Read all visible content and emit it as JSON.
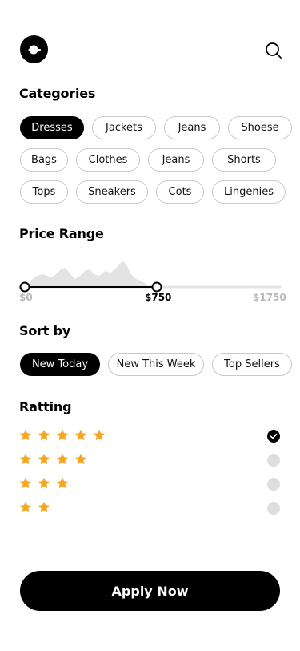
{
  "header": {
    "back_icon": "back-arrow-icon",
    "search_icon": "search-icon"
  },
  "categories": {
    "title": "Categories",
    "items": [
      {
        "label": "Dresses",
        "selected": true
      },
      {
        "label": "Jackets",
        "selected": false
      },
      {
        "label": "Jeans",
        "selected": false
      },
      {
        "label": "Shoese",
        "selected": false
      },
      {
        "label": "Bags",
        "selected": false
      },
      {
        "label": "Clothes",
        "selected": false
      },
      {
        "label": "Jeans",
        "selected": false
      },
      {
        "label": "Shorts",
        "selected": false
      },
      {
        "label": "Tops",
        "selected": false
      },
      {
        "label": "Sneakers",
        "selected": false
      },
      {
        "label": "Cots",
        "selected": false
      },
      {
        "label": "Lingenies",
        "selected": false
      }
    ]
  },
  "price": {
    "title": "Price Range",
    "min_label": "$0",
    "current_label": "$750",
    "max_label": "$1750",
    "min": 0,
    "max": 1750,
    "selected_min": 0,
    "selected_max": 750
  },
  "sort": {
    "title": "Sort by",
    "options": [
      {
        "label": "New Today",
        "selected": true
      },
      {
        "label": "New This Week",
        "selected": false
      },
      {
        "label": "Top Sellers",
        "selected": false
      }
    ]
  },
  "rating": {
    "title": "Ratting",
    "rows": [
      {
        "stars": 5,
        "checked": true
      },
      {
        "stars": 4,
        "checked": false
      },
      {
        "stars": 3,
        "checked": false
      },
      {
        "stars": 2,
        "checked": false
      }
    ],
    "star_color": "#F5A623"
  },
  "apply_button": {
    "label": "Apply Now"
  }
}
